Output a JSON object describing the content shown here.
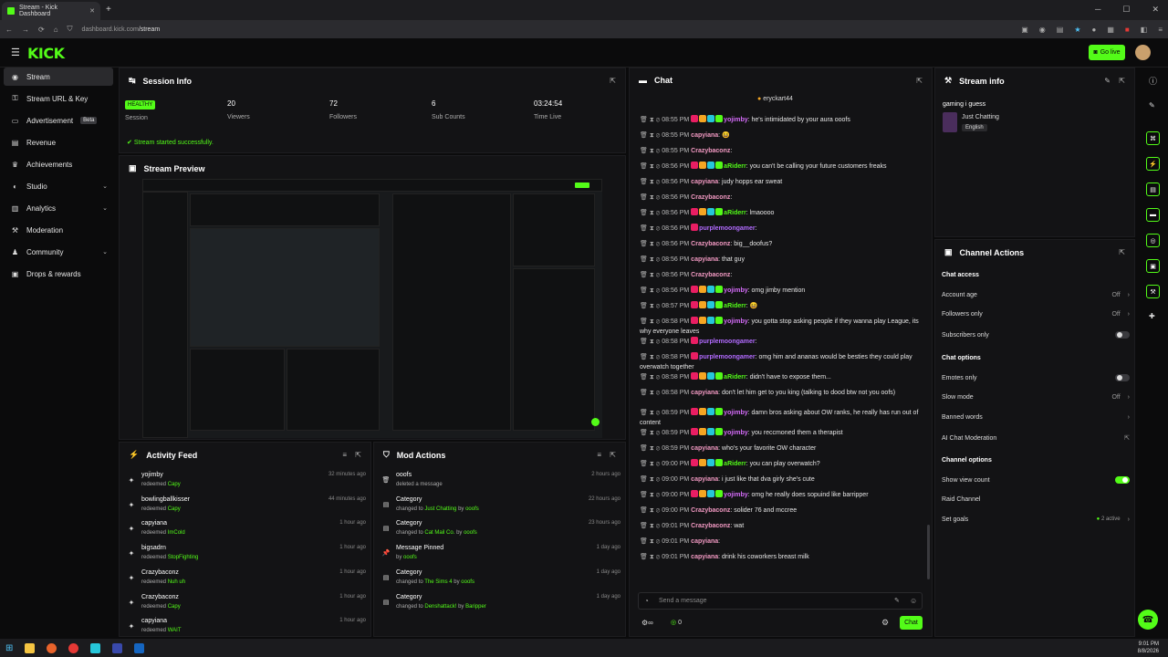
{
  "browser": {
    "tab_title": "Stream - Kick Dashboard",
    "url_host": "dashboard.kick.com",
    "url_path": "/stream",
    "clock_time": "9:01 PM",
    "clock_date": "8/8/2026"
  },
  "topbar": {
    "logo": "KICK",
    "go_live": "Go live"
  },
  "sidebar": {
    "items": [
      {
        "label": "Stream",
        "icon": "stream-icon"
      },
      {
        "label": "Stream URL & Key",
        "icon": "link-icon"
      },
      {
        "label": "Advertisement",
        "badge": "Beta",
        "icon": "ad-icon"
      },
      {
        "label": "Revenue",
        "icon": "revenue-icon"
      },
      {
        "label": "Achievements",
        "icon": "trophy-icon"
      },
      {
        "label": "Studio",
        "icon": "studio-icon"
      },
      {
        "label": "Analytics",
        "icon": "analytics-icon"
      },
      {
        "label": "Moderation",
        "icon": "moderation-icon"
      },
      {
        "label": "Community",
        "icon": "community-icon"
      },
      {
        "label": "Drops & rewards",
        "icon": "gift-icon"
      }
    ]
  },
  "session": {
    "title": "Session Info",
    "status": "HEALTHY",
    "status_label": "Session",
    "viewers": "20",
    "viewers_label": "Viewers",
    "followers": "72",
    "followers_label": "Followers",
    "subs": "6",
    "subs_label": "Sub Counts",
    "time": "03:24:54",
    "time_label": "Time Live",
    "message": "Stream started successfully."
  },
  "preview": {
    "title": "Stream Preview"
  },
  "activity": {
    "title": "Activity Feed",
    "items": [
      {
        "name": "yojimby",
        "action": "redeemed",
        "reward": "Capy",
        "time": "32 minutes ago"
      },
      {
        "name": "bowlingballkisser",
        "action": "redeemed",
        "reward": "Capy",
        "time": "44 minutes ago"
      },
      {
        "name": "capyiana",
        "action": "redeemed",
        "reward": "ImCold",
        "time": "1 hour ago"
      },
      {
        "name": "bigsadrn",
        "action": "redeemed",
        "reward": "StopFighting",
        "time": "1 hour ago"
      },
      {
        "name": "Crazybaconz",
        "action": "redeemed",
        "reward": "Nuh uh",
        "time": "1 hour ago"
      },
      {
        "name": "Crazybaconz",
        "action": "redeemed",
        "reward": "Capy",
        "time": "1 hour ago"
      },
      {
        "name": "capyiana",
        "action": "redeemed",
        "reward": "WAIT",
        "time": "1 hour ago"
      }
    ]
  },
  "mod": {
    "title": "Mod Actions",
    "items": [
      {
        "name": "ooofs",
        "sub1": "deleted a message",
        "hl": "",
        "sub2": "",
        "by": "",
        "time": "2 hours ago",
        "icon": "trash-icon"
      },
      {
        "name": "Category",
        "sub1": "changed to",
        "hl": "Just Chatting",
        "sub2": "by",
        "by": "ooofs",
        "time": "22 hours ago",
        "icon": "category-icon"
      },
      {
        "name": "Category",
        "sub1": "changed to",
        "hl": "Cat Mail Co.",
        "sub2": "by",
        "by": "ooofs",
        "time": "23 hours ago",
        "icon": "category-icon"
      },
      {
        "name": "Message Pinned",
        "sub1": "by",
        "hl": "ooofs",
        "sub2": "",
        "by": "",
        "time": "1 day ago",
        "icon": "pin-icon"
      },
      {
        "name": "Category",
        "sub1": "changed to",
        "hl": "The Sims 4",
        "sub2": "by",
        "by": "ooofs",
        "time": "1 day ago",
        "icon": "category-icon"
      },
      {
        "name": "Category",
        "sub1": "changed to",
        "hl": "Denshattack!",
        "sub2": "by",
        "by": "Baripper",
        "time": "1 day ago",
        "icon": "category-icon"
      }
    ]
  },
  "chat": {
    "title": "Chat",
    "pinned_user": "eryckart44",
    "placeholder": "Send a message",
    "send": "Chat",
    "viewer_count": "0",
    "messages": [
      {
        "t": "08:55 PM",
        "u": "yojimby",
        "c": "#d36bf7",
        "m": "he's intimidated by your aura ooofs",
        "b": 4
      },
      {
        "t": "08:55 PM",
        "u": "capyiana",
        "c": "#f39ac3",
        "m": "😆",
        "b": 0
      },
      {
        "t": "08:55 PM",
        "u": "Crazybaconz",
        "c": "#f39ac3",
        "m": "",
        "b": 0
      },
      {
        "t": "08:56 PM",
        "u": "aRiderr",
        "c": "#53fc18",
        "m": "you can't be calling your future customers freaks",
        "b": 4
      },
      {
        "t": "08:56 PM",
        "u": "capyiana",
        "c": "#f39ac3",
        "m": "judy hopps ear sweat",
        "b": 0
      },
      {
        "t": "08:56 PM",
        "u": "Crazybaconz",
        "c": "#f39ac3",
        "m": "",
        "b": 0
      },
      {
        "t": "08:56 PM",
        "u": "aRiderr",
        "c": "#53fc18",
        "m": "lmaoooo",
        "b": 4
      },
      {
        "t": "08:56 PM",
        "u": "purplemoongamer",
        "c": "#b26bff",
        "m": "",
        "b": 1
      },
      {
        "t": "08:56 PM",
        "u": "Crazybaconz",
        "c": "#f39ac3",
        "m": "big__doofus?",
        "b": 0
      },
      {
        "t": "08:56 PM",
        "u": "capyiana",
        "c": "#f39ac3",
        "m": "that guy",
        "b": 0
      },
      {
        "t": "08:56 PM",
        "u": "Crazybaconz",
        "c": "#f39ac3",
        "m": "",
        "b": 0
      },
      {
        "t": "08:56 PM",
        "u": "yojimby",
        "c": "#d36bf7",
        "m": "omg jimby mention",
        "b": 4
      },
      {
        "t": "08:57 PM",
        "u": "aRiderr",
        "c": "#53fc18",
        "m": "😆",
        "b": 4
      },
      {
        "t": "08:58 PM",
        "u": "yojimby",
        "c": "#d36bf7",
        "m": "you gotta stop asking people if they wanna play League, its why everyone leaves",
        "b": 4
      },
      {
        "t": "08:58 PM",
        "u": "purplemoongamer",
        "c": "#b26bff",
        "m": "",
        "b": 1
      },
      {
        "t": "08:58 PM",
        "u": "purplemoongamer",
        "c": "#b26bff",
        "m": "omg him and ananas would be besties they could play overwatch together",
        "b": 1
      },
      {
        "t": "08:58 PM",
        "u": "aRiderr",
        "c": "#53fc18",
        "m": "didn't have to expose them...",
        "b": 4
      },
      {
        "t": "08:58 PM",
        "u": "capyiana",
        "c": "#f39ac3",
        "m": "don't let him get to you king (talking to dood btw not you oofs)",
        "b": 0
      },
      {
        "t": "08:59 PM",
        "u": "yojimby",
        "c": "#d36bf7",
        "m": "damn bros asking about OW ranks, he really has run out of content",
        "b": 4
      },
      {
        "t": "08:59 PM",
        "u": "yojimby",
        "c": "#d36bf7",
        "m": "you reccmoned them a therapist",
        "b": 4
      },
      {
        "t": "08:59 PM",
        "u": "capyiana",
        "c": "#f39ac3",
        "m": "who's your favorite OW character",
        "b": 0
      },
      {
        "t": "09:00 PM",
        "u": "aRiderr",
        "c": "#53fc18",
        "m": "you can play overwatch?",
        "b": 4
      },
      {
        "t": "09:00 PM",
        "u": "capyiana",
        "c": "#f39ac3",
        "m": "i just like that dva girly she's cute",
        "b": 0
      },
      {
        "t": "09:00 PM",
        "u": "yojimby",
        "c": "#d36bf7",
        "m": "omg he really does sopuind like barripper",
        "b": 4
      },
      {
        "t": "09:00 PM",
        "u": "Crazybaconz",
        "c": "#f39ac3",
        "m": "solider 76 and mccree",
        "b": 0
      },
      {
        "t": "09:01 PM",
        "u": "Crazybaconz",
        "c": "#f39ac3",
        "m": "wat",
        "b": 0
      },
      {
        "t": "09:01 PM",
        "u": "capyiana",
        "c": "#f39ac3",
        "m": "",
        "b": 0
      },
      {
        "t": "09:01 PM",
        "u": "capyiana",
        "c": "#f39ac3",
        "m": "drink his coworkers breast milk",
        "b": 0
      }
    ]
  },
  "streaminfo": {
    "title": "Stream info",
    "stream_title": "gaming i guess",
    "category": "Just Chatting",
    "language": "English"
  },
  "actions": {
    "title": "Channel Actions",
    "access_header": "Chat access",
    "account_age": "Account age",
    "account_age_val": "Off",
    "followers_only": "Followers only",
    "followers_only_val": "Off",
    "subs_only": "Subscribers only",
    "options_header": "Chat options",
    "emotes_only": "Emotes only",
    "slow_mode": "Slow mode",
    "slow_mode_val": "Off",
    "banned_words": "Banned words",
    "ai_mod": "AI Chat Moderation",
    "channel_header": "Channel options",
    "show_view_count": "Show view count",
    "raid": "Raid Channel",
    "goals": "Set goals",
    "goals_val": "2 active"
  },
  "colors": {
    "accent": "#53fc18",
    "bg": "#0b0b0c",
    "panel": "#131315"
  }
}
